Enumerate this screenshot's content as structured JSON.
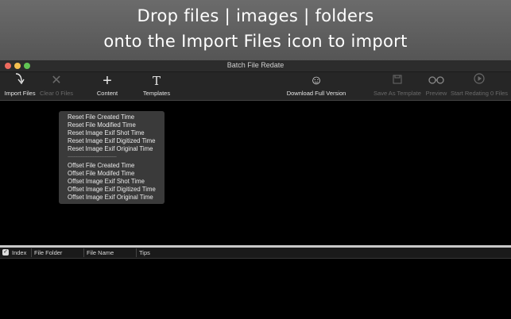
{
  "banner": {
    "line1": "Drop files | images | folders",
    "line2": "onto the Import Files icon to import"
  },
  "window": {
    "title": "Batch File Redate"
  },
  "toolbar": {
    "import_files": "Import Files",
    "clear_files": "Clear 0 Files",
    "content": "Content",
    "templates": "Templates",
    "download_full": "Download Full Version",
    "save_template": "Save As Template",
    "preview": "Preview",
    "start_redating": "Start Redating 0 Files"
  },
  "menu": {
    "reset_items": [
      "Reset File Created Time",
      "Reset File Modified Time",
      "Reset Image Exif Shot Time",
      "Reset Image Exif Digitized Time",
      "Reset Image Exif Original Time"
    ],
    "separator": "-----------------------------------------",
    "offset_items": [
      "Offset File Created Time",
      "Offset File Modifed Time",
      "Offset Image Exif Shot Time",
      "Offset Image Exif Digitized Time",
      "Offset Image Exif Original Time"
    ]
  },
  "table": {
    "columns": [
      "Index",
      "File Folder",
      "File Name",
      "Tips"
    ]
  },
  "icons": {
    "import": "import-arrow-icon",
    "clear": "x-icon",
    "content": "plus-icon",
    "templates": "text-t-icon",
    "download": "smiley-icon",
    "save": "floppy-icon",
    "preview": "glasses-icon",
    "start": "play-circle-icon"
  }
}
